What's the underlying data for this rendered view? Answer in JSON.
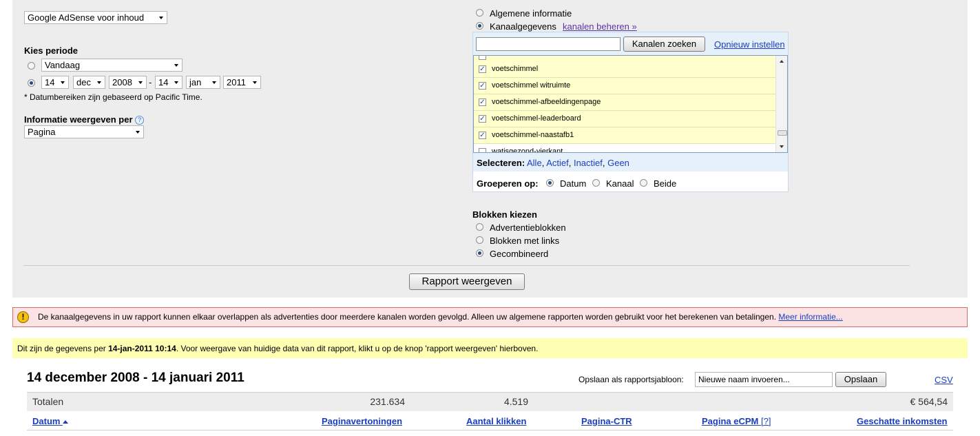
{
  "product_select": {
    "value": "Google AdSense voor inhoud"
  },
  "period": {
    "heading": "Kies periode",
    "preset_value": "Vandaag",
    "from": {
      "day": "14",
      "month": "dec",
      "year": "2008"
    },
    "dash": "-",
    "to": {
      "day": "14",
      "month": "jan",
      "year": "2011"
    },
    "note": "* Datumbereiken zijn gebaseerd op Pacific Time."
  },
  "show_per": {
    "heading": "Informatie weergeven per",
    "help": "?",
    "value": "Pagina"
  },
  "data_type": {
    "option_general": "Algemene informatie",
    "option_channel": "Kanaalgegevens",
    "manage_link": "kanalen beheren »"
  },
  "channels": {
    "search_placeholder": "",
    "search_button": "Kanalen zoeken",
    "reset_link": "Opnieuw instellen",
    "items": [
      {
        "name": "voetschimmel",
        "checked": "✓"
      },
      {
        "name": "voetschimmel witruimte",
        "checked": "✓"
      },
      {
        "name": "voetschimmel-afbeeldingenpage",
        "checked": "✓"
      },
      {
        "name": "voetschimmel-leaderboard",
        "checked": "✓"
      },
      {
        "name": "voetschimmel-naastafb1",
        "checked": "✓"
      },
      {
        "name": "watisgezond-vierkant",
        "checked": ""
      }
    ],
    "select_label": "Selecteren:",
    "select_options": [
      "Alle",
      "Actief",
      "Inactief",
      "Geen"
    ],
    "group_label": "Groeperen op:",
    "group_options": [
      "Datum",
      "Kanaal",
      "Beide"
    ]
  },
  "blocks": {
    "heading": "Blokken kiezen",
    "options": [
      "Advertentieblokken",
      "Blokken met links",
      "Gecombineerd"
    ]
  },
  "report_button": "Rapport weergeven",
  "warning": {
    "text": "De kanaalgegevens in uw rapport kunnen elkaar overlappen als advertenties door meerdere kanalen worden gevolgd. Alleen uw algemene rapporten worden gebruikt voor het berekenen van betalingen.",
    "link": "Meer informatie..."
  },
  "notice": {
    "prefix": "Dit zijn de gegevens per ",
    "timestamp": "14-jan-2011 10:14",
    "suffix": ". Voor weergave van huidige data van dit rapport, klikt u op de knop 'rapport weergeven' hierboven."
  },
  "report": {
    "title": "14 december 2008 - 14 januari 2011",
    "save_label": "Opslaan als rapportsjabloon:",
    "save_input_value": "Nieuwe naam invoeren...",
    "save_button": "Opslaan",
    "csv": "CSV",
    "totals_label": "Totalen",
    "totals_impressions": "231.634",
    "totals_clicks": "4.519",
    "totals_earnings": "€ 564,54",
    "columns": [
      "Datum",
      "Paginavertoningen",
      "Aantal klikken",
      "Pagina-CTR",
      "Pagina eCPM",
      "Geschatte inkomsten"
    ],
    "ecpm_help": "[?]"
  }
}
